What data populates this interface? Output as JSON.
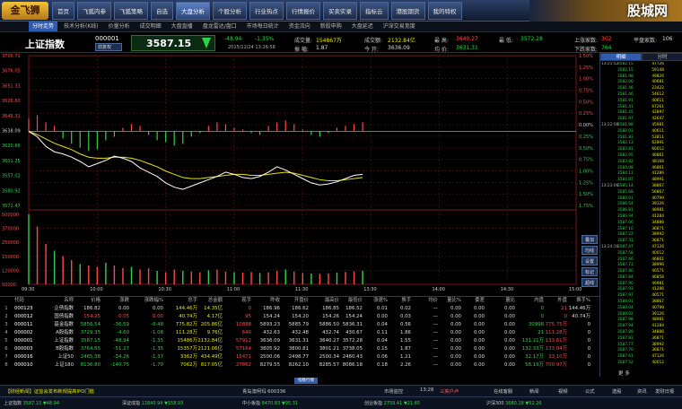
{
  "app": {
    "logo": "金飞狮",
    "site_watermark": "股城网"
  },
  "menu": [
    "首页",
    "飞狐内参",
    "飞狐策略",
    "自选",
    "大盘分析",
    "个股分析",
    "行业热点",
    "行情报价",
    "买卖实录",
    "指标云",
    "港股期货",
    "我的特权"
  ],
  "menu_active": 4,
  "subtabs": [
    "分时走势",
    "技术分析(K线)",
    "价量分析",
    "成交明细",
    "大盘直播",
    "盘龙雷达/盘口",
    "市场每日统计",
    "资金流向",
    "新股申购",
    "大盘延迟",
    "沪深交易宽度"
  ],
  "subtab_active": 0,
  "stock": {
    "name": "上证指数",
    "code": "000001",
    "period": "前复权",
    "price": "3587.15",
    "change": "-48.94",
    "change_pct": "-1.35%",
    "datetime": "2015/12/24 13:26:58"
  },
  "quote": {
    "volume_label": "成交量:",
    "volume": "154867万",
    "turnover_label": "成交额:",
    "turnover": "2132.84亿",
    "high_label": "最 高:",
    "high": "3640.27",
    "low_label": "最 低:",
    "low": "3572.28",
    "amplitude_label": "振 幅:",
    "amplitude": "1.87",
    "open_label": "今 开:",
    "open": "3636.09",
    "mid_label": "均 价:",
    "mid": "3631.31",
    "up_label": "上涨家数:",
    "up_count": "302",
    "down_label": "下跌家数:",
    "down_count": "764",
    "flat_label": "平盘家数:",
    "flat_count": "106"
  },
  "chart_data": {
    "type": "line",
    "price_ticks": [
      "3706.71",
      "3676.05",
      "3651.33",
      "3626.60",
      "3645.31",
      "3638.09",
      "3620.66",
      "3601.25",
      "3557.02",
      "3580.92",
      "3571.47"
    ],
    "pct_ticks": [
      "1.50%",
      "1.25%",
      "1.00%",
      "0.75%",
      "0.50%",
      "0.25%",
      "0.00%",
      "0.25%",
      "0.50%",
      "0.75%",
      "1.00%",
      "1.25%",
      "1.50%",
      "1.75%"
    ],
    "vol_ticks": [
      "500000",
      "370000",
      "250000",
      "150000",
      "120000",
      "50000"
    ],
    "time_ticks": [
      "09:30",
      "10:00",
      "10:30",
      "11:00",
      "11:30",
      "13:30",
      "14:00",
      "14:30",
      "15:00"
    ],
    "prev_close": 3636.09,
    "ylim": [
      3567.0,
      3706.71
    ],
    "price_series": [
      3636,
      3631,
      3622,
      3617,
      3615,
      3612,
      3608,
      3603,
      3606,
      3609,
      3613,
      3611,
      3608,
      3602,
      3598,
      3594,
      3588,
      3584,
      3582,
      3585,
      3588,
      3591,
      3594,
      3598,
      3596,
      3593,
      3592,
      3594,
      3598,
      3603,
      3600,
      3596,
      3592,
      3588,
      3586,
      3587,
      3589,
      3592,
      3595,
      3596
    ],
    "avg_series": [
      3636,
      3633,
      3629,
      3625,
      3622,
      3619,
      3615,
      3612,
      3611,
      3611,
      3612,
      3612,
      3611,
      3609,
      3606,
      3603,
      3599,
      3596,
      3593,
      3592,
      3592,
      3593,
      3594,
      3595,
      3596,
      3596,
      3595,
      3595,
      3596,
      3597,
      3598,
      3597,
      3595,
      3593,
      3591,
      3590,
      3590,
      3591,
      3592,
      3593
    ],
    "diff_series": [
      14,
      18,
      10,
      6,
      -8,
      -14,
      -18,
      -22,
      -20,
      -10,
      -6,
      4,
      8,
      6,
      -4,
      -10,
      -12,
      -16,
      -14,
      -6,
      -2,
      6,
      10,
      8,
      4,
      2,
      -2,
      -4,
      6,
      10,
      12,
      8,
      2,
      -4,
      -6,
      -2,
      4,
      6,
      8,
      10
    ],
    "volume_series": [
      520000,
      430000,
      300000,
      250000,
      210000,
      180000,
      150000,
      140000,
      130000,
      160000,
      140000,
      120000,
      130000,
      110000,
      120000,
      100000,
      90000,
      110000,
      100000,
      95000,
      90000,
      105000,
      110000,
      95000,
      90000,
      88000,
      92000,
      85000,
      90000,
      100000,
      110000,
      95000,
      85000,
      80000,
      78000,
      82000,
      88000,
      92000,
      96000,
      100000
    ]
  },
  "side_buttons": [
    "叠加",
    "均线",
    "设置",
    "标记",
    "超线"
  ],
  "right_panel": {
    "tabs": [
      "明细",
      "分时"
    ],
    "ticks": [
      [
        "13:21:52",
        "3582.15",
        "47726"
      ],
      [
        "",
        "3582.15",
        "59148"
      ],
      [
        "",
        "3581.98",
        "49826"
      ],
      [
        "",
        "3582.00",
        "40681"
      ],
      [
        "",
        "3581.46",
        "23422"
      ],
      [
        "",
        "3581.46",
        "54612"
      ],
      [
        "",
        "3581.91",
        "40611"
      ],
      [
        "",
        "3581.41",
        "67261"
      ],
      [
        "",
        "3581.45",
        "42897"
      ],
      [
        "",
        "3581.97",
        "42647"
      ],
      [
        "13:22:08",
        "3581.98",
        "45981"
      ],
      [
        "",
        "3582.03",
        "40611"
      ],
      [
        "",
        "3581.83",
        "53811"
      ],
      [
        "",
        "3582.13",
        "62891"
      ],
      [
        "",
        "3582.81",
        "60012"
      ],
      [
        "",
        "3582.95",
        "46861"
      ],
      [
        "",
        "3583.82",
        "48166"
      ],
      [
        "",
        "3584.08",
        "46861"
      ],
      [
        "",
        "3584.11",
        "41286"
      ],
      [
        "",
        "3584.87",
        "48991"
      ],
      [
        "13:23:06",
        "3585.14",
        "38867"
      ],
      [
        "",
        "3585.68",
        "56867"
      ],
      [
        "",
        "3586.01",
        "40799"
      ],
      [
        "",
        "3586.54",
        "39126"
      ],
      [
        "",
        "3586.81",
        "48981"
      ],
      [
        "",
        "3586.94",
        "41284"
      ],
      [
        "",
        "3587.06",
        "34886"
      ],
      [
        "",
        "3587.10",
        "36871"
      ],
      [
        "",
        "3587.22",
        "38992"
      ],
      [
        "",
        "3587.31",
        "36871"
      ],
      [
        "13:24:16",
        "3587.47",
        "47126"
      ],
      [
        "",
        "3587.58",
        "40012"
      ],
      [
        "",
        "3587.66",
        "46861"
      ],
      [
        "",
        "3587.73",
        "38996"
      ],
      [
        "",
        "3587.80",
        "40571"
      ],
      [
        "",
        "3587.84",
        "46856"
      ],
      [
        "",
        "3587.90",
        "49981"
      ],
      [
        "",
        "3587.93",
        "41286"
      ],
      [
        "",
        "3587.97",
        "40571"
      ],
      [
        "",
        "3588.01",
        "38867"
      ],
      [
        "",
        "3588.04",
        "40799"
      ],
      [
        "",
        "3588.02",
        "39126"
      ],
      [
        "",
        "3587.98",
        "48981"
      ],
      [
        "",
        "3587.94",
        "41284"
      ],
      [
        "",
        "3587.89",
        "34886"
      ],
      [
        "",
        "3587.83",
        "36871"
      ],
      [
        "",
        "3587.77",
        "38992"
      ],
      [
        "",
        "3587.70",
        "36871"
      ],
      [
        "",
        "3587.61",
        "47126"
      ],
      [
        "",
        "3587.52",
        "40012"
      ]
    ],
    "more": "更 多"
  },
  "table": {
    "headers": [
      "",
      "代码",
      "名称",
      "价格",
      "涨跌",
      "涨跌幅%",
      "总手",
      "总金额",
      "现手",
      "昨收",
      "开盘价",
      "最高价",
      "最低价",
      "涨速%",
      "换手",
      "均价",
      "量比%",
      "委差",
      "量比",
      "内盘",
      "外盘",
      "换手%"
    ],
    "rows": [
      [
        "1",
        "000123",
        "企债指数",
        "186.82",
        "0.00",
        "0.00",
        "144.46万",
        "14.35亿",
        "0",
        "186.96",
        "186.62",
        "186.85",
        "186.52",
        "0.01",
        "0.02",
        "—",
        "0.00",
        "0.00",
        "0.00",
        "0",
        "21",
        "144.46万"
      ],
      [
        "2",
        "000012",
        "国债指数",
        "154.25",
        "0.05",
        "0.00",
        "40.74万",
        "4.17亿",
        "95",
        "154.24",
        "154.20",
        "154.26",
        "154.24",
        "0.00",
        "0.03",
        "—",
        "0.00",
        "0.00",
        "0.00",
        "0",
        "0",
        "40.74万"
      ],
      [
        "3",
        "000011",
        "基金指数",
        "5856.54",
        "-36.59",
        "-0.48",
        "775.82万",
        "205.86亿",
        "10888",
        "5893.23",
        "5885.79",
        "5886.50",
        "5836.31",
        "0.04",
        "0.56",
        "—",
        "0.00",
        "0.00",
        "0.00",
        "30998",
        "775.75万",
        "0"
      ],
      [
        "4",
        "000002",
        "A股指数",
        "3729.35",
        "-4.60",
        "-1.08",
        "111.28万",
        "9.76亿",
        "640",
        "432.63",
        "432.48",
        "432.74",
        "430.67",
        "0.11",
        "1.86",
        "—",
        "0.00",
        "0.00",
        "0.00",
        "21",
        "111.28万",
        "0"
      ],
      [
        "5",
        "000001",
        "上证指数",
        "3587.15",
        "-48.94",
        "-1.35",
        "15486万",
        "2132.84亿",
        "57912",
        "3636.09",
        "3631.31",
        "3640.27",
        "3572.28",
        "0.04",
        "1.55",
        "—",
        "0.00",
        "0.00",
        "0.00",
        "131.21万",
        "133.61万",
        "0"
      ],
      [
        "6",
        "000003",
        "B股指数",
        "3764.65",
        "-51.27",
        "-1.35",
        "15357万",
        "2121.06亿",
        "57164",
        "3805.92",
        "3800.81",
        "3801.21",
        "3738.05",
        "0.15",
        "1.87",
        "—",
        "0.00",
        "0.00",
        "0.00",
        "132.33万",
        "133.04万",
        "0"
      ],
      [
        "7",
        "000016",
        "上证50",
        "2465.38",
        "-34.26",
        "-1.37",
        "3362万",
        "434.49亿",
        "15471",
        "2500.06",
        "2498.77",
        "2500.34",
        "2460.43",
        "0.06",
        "1.21",
        "—",
        "0.00",
        "0.00",
        "0.00",
        "32.17万",
        "33.10万",
        "0"
      ],
      [
        "8",
        "000010",
        "上证180",
        "8136.80",
        "-140.75",
        "-1.70",
        "7062万",
        "817.05亿",
        "27862",
        "8279.55",
        "8262.10",
        "8285.57",
        "8086.18",
        "0.18",
        "2.26",
        "—",
        "0.00",
        "0.00",
        "0.00",
        "58.19万",
        "700.97万",
        "0"
      ]
    ]
  },
  "table_tab": "指数行情",
  "bottom_bar": {
    "ticker": "【财经新闻】证监会发布新规提高IPO门槛",
    "company": "青岛澳柯玛 600336",
    "status": "市场监控",
    "time": "13:28",
    "alert": "三夹户卢",
    "buttons": [
      "在线客服",
      "新闻",
      "视频",
      "公式",
      "选股",
      "资讯",
      "发财日报"
    ]
  },
  "indices": [
    {
      "name": "上证指数",
      "value": "3587.15",
      "chg": "▼48.94"
    },
    {
      "name": "深证成指",
      "value": "12840.94",
      "chg": "▼158.93"
    },
    {
      "name": "中小板指",
      "value": "8470.83",
      "chg": "▼95.31"
    },
    {
      "name": "创业板指",
      "value": "2759.41",
      "chg": "▼21.65"
    },
    {
      "name": "沪深300",
      "value": "3680.18",
      "chg": "▼52.26"
    }
  ],
  "colors": {
    "up": "#ff4848",
    "down": "#2fd24a",
    "grid": "#5a1212",
    "price_line": "#ffffff",
    "avg_line": "#e6e600"
  }
}
